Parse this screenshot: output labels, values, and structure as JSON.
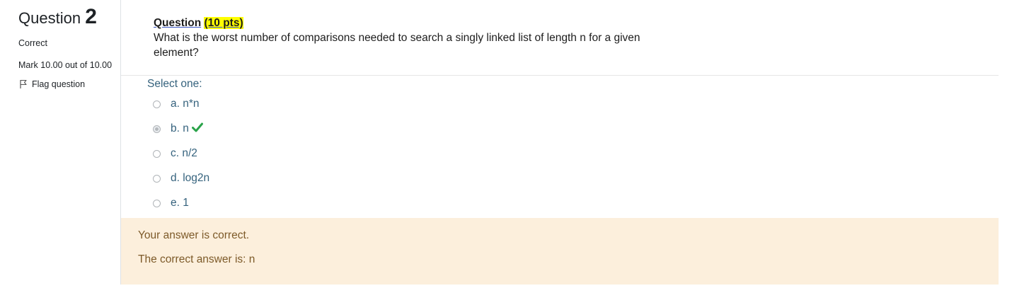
{
  "info": {
    "question_word": "Question",
    "question_number": "2",
    "state": "Correct",
    "grade": "Mark 10.00 out of 10.00",
    "flag_label": "Flag question",
    "flag_icon": "flag-outline-icon"
  },
  "question": {
    "heading_word": "Question",
    "points": "(10 pts)",
    "text": "What is the worst number of comparisons needed to search a singly linked list of length n for a given element?"
  },
  "answer": {
    "prompt": "Select one:",
    "options": [
      {
        "label": "a. n*n",
        "selected": false
      },
      {
        "label": "b. n",
        "selected": true,
        "correct_mark": "check-icon"
      },
      {
        "label": "c. n/2",
        "selected": false
      },
      {
        "label": "d. log2n",
        "selected": false
      },
      {
        "label": "e. 1",
        "selected": false
      }
    ]
  },
  "feedback": {
    "result": "Your answer is correct.",
    "correct_answer": "The correct answer is: n"
  },
  "colors": {
    "option_text": "#35627d",
    "feedback_bg": "#fcefdc",
    "feedback_text": "#7d5a29",
    "check": "#2aa34a",
    "highlight": "#ffff00"
  }
}
